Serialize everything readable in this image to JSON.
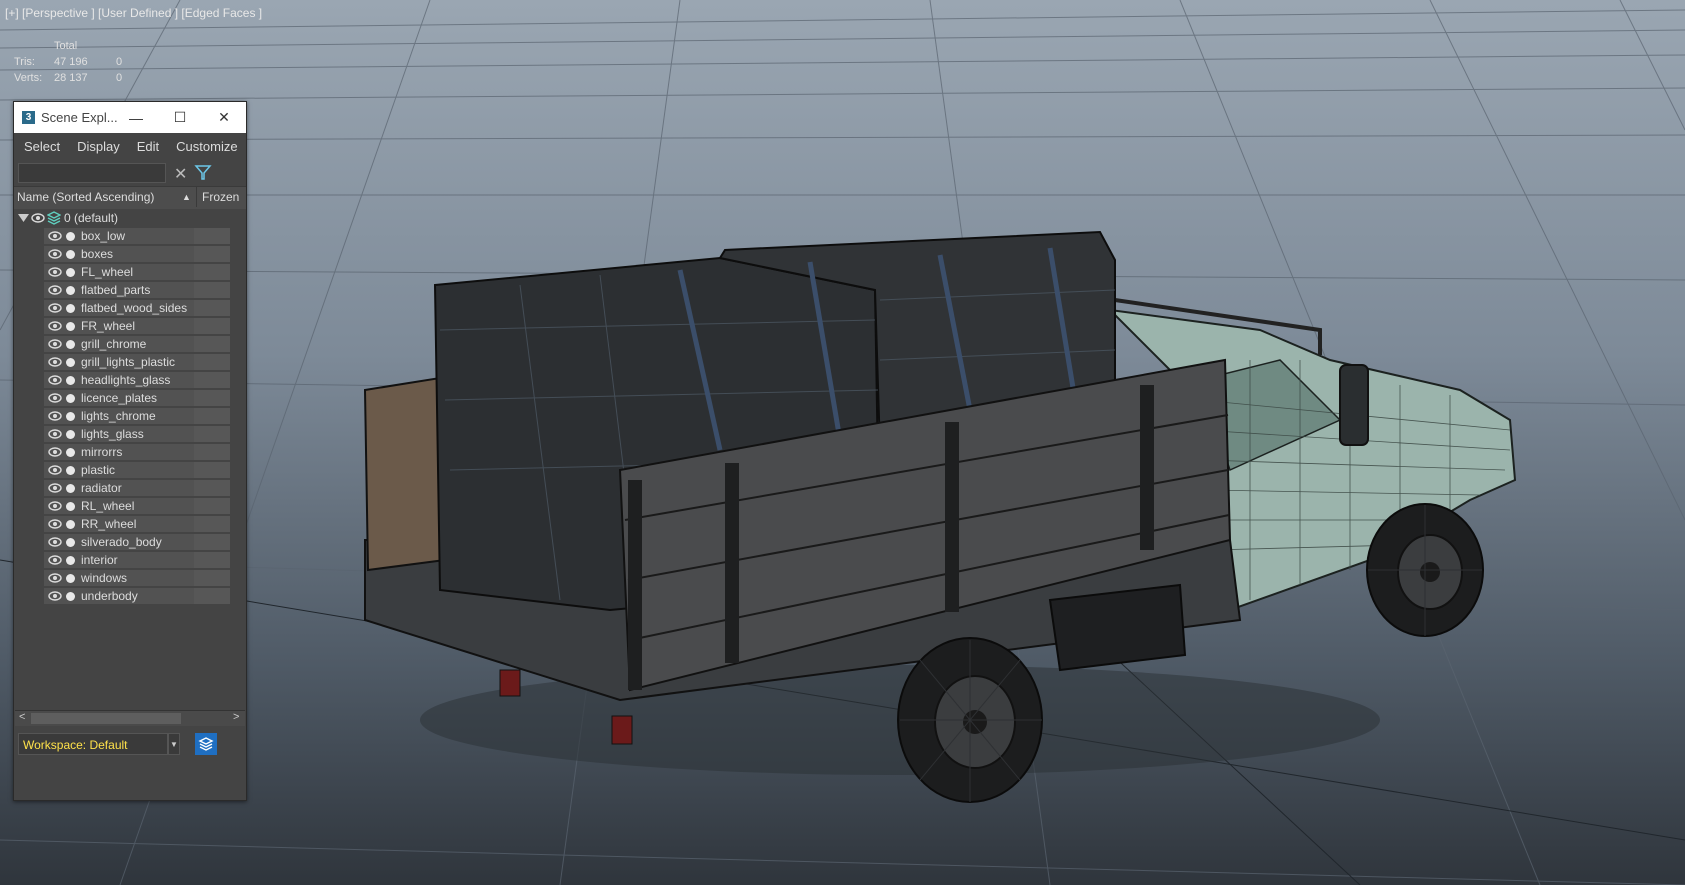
{
  "viewport": {
    "label": "[+] [Perspective ] [User Defined ] [Edged Faces ]",
    "stats": {
      "header": "Total",
      "rows": [
        {
          "label": "Tris:",
          "total": "47 196",
          "sel": "0"
        },
        {
          "label": "Verts:",
          "total": "28 137",
          "sel": "0"
        }
      ]
    }
  },
  "scene_explorer": {
    "title": "Scene Expl...",
    "logo": "3",
    "window_buttons": {
      "minimize": "—",
      "maximize": "☐",
      "close": "✕"
    },
    "menus": [
      "Select",
      "Display",
      "Edit",
      "Customize"
    ],
    "search": {
      "value": "",
      "placeholder": ""
    },
    "columns": {
      "name": "Name (Sorted Ascending)",
      "sort": "▲",
      "frozen": "Frozen"
    },
    "layer": {
      "label": "0 (default)"
    },
    "objects": [
      "box_low",
      "boxes",
      "FL_wheel",
      "flatbed_parts",
      "flatbed_wood_sides",
      "FR_wheel",
      "grill_chrome",
      "grill_lights_plastic",
      "headlights_glass",
      "licence_plates",
      "lights_chrome",
      "lights_glass",
      "mirrorrs",
      "plastic",
      "radiator",
      "RL_wheel",
      "RR_wheel",
      "silverado_body",
      "interior",
      "windows",
      "underbody"
    ],
    "workspace": "Workspace: Default",
    "icons": {
      "logo": "max-logo-icon",
      "clear": "close-icon",
      "filter": "filter-icon",
      "expand": "triangle-down-icon",
      "eye": "eye-icon",
      "layer": "layer-stack-icon"
    },
    "colors": {
      "accent": "#1f6fc2",
      "workspace_text": "#ffe24a"
    }
  }
}
